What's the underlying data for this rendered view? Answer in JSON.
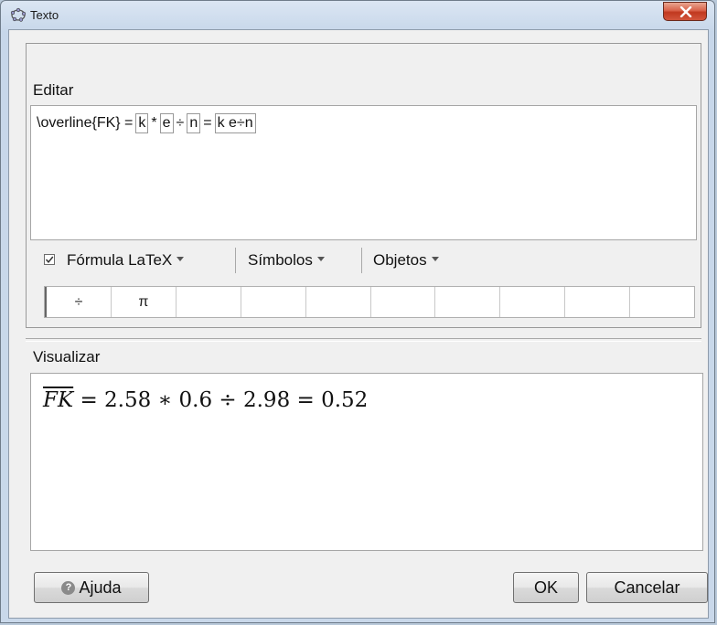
{
  "window": {
    "title": "Texto",
    "close_icon": "close-icon"
  },
  "edit": {
    "section_label": "Editar",
    "tokens": [
      {
        "text": "\\overline{FK} =",
        "boxed": false
      },
      {
        "text": "k",
        "boxed": true
      },
      {
        "text": "*",
        "boxed": false
      },
      {
        "text": "e",
        "boxed": true
      },
      {
        "text": "÷",
        "boxed": false
      },
      {
        "text": "n",
        "boxed": true
      },
      {
        "text": "=",
        "boxed": false
      },
      {
        "text": "k e÷n",
        "boxed": true
      }
    ]
  },
  "toolbar": {
    "latex_checked": true,
    "latex_label": "Fórmula LaTeX",
    "symbols_label": "Símbolos",
    "objects_label": "Objetos"
  },
  "symbols": [
    "÷",
    "π",
    "",
    "",
    "",
    "",
    "",
    "",
    "",
    ""
  ],
  "preview": {
    "section_label": "Visualizar",
    "overline_part": "FK",
    "rest": " = 2.58 ∗ 0.6 ÷ 2.98 = 0.52"
  },
  "buttons": {
    "help_label": "Ajuda",
    "help_icon": "?",
    "ok_label": "OK",
    "cancel_label": "Cancelar"
  }
}
